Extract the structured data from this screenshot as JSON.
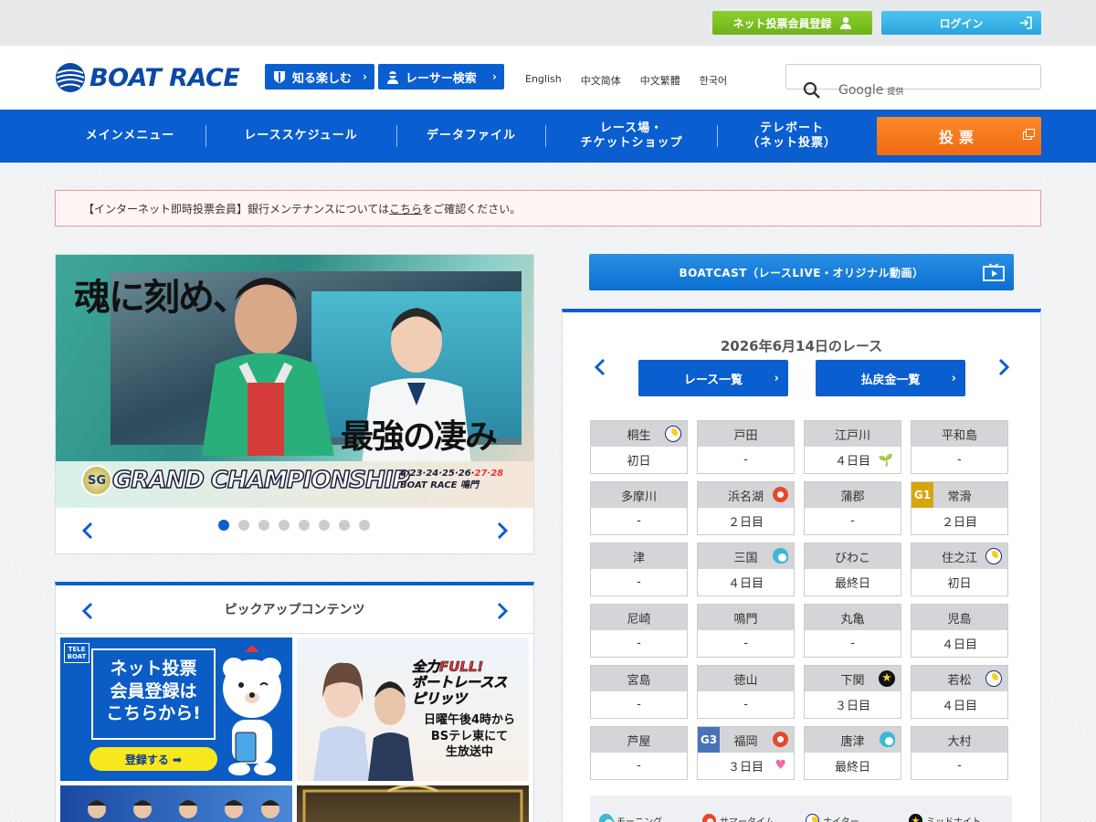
{
  "topbar": {
    "register_label": "ネット投票会員登録",
    "login_label": "ログイン"
  },
  "header": {
    "logo": "BOAT RACE",
    "btn_enjoy": "知る楽しむ",
    "btn_racer": "レーサー検索",
    "langs": [
      "English",
      "中文简体",
      "中文繁體",
      "한국어"
    ],
    "search_brand": "Google",
    "search_suffix": "提供"
  },
  "nav": {
    "items": [
      "メインメニュー",
      "レーススケジュール",
      "データファイル",
      "レース場・\nチケットショップ",
      "テレボート\n（ネット投票）"
    ],
    "vote": "投票"
  },
  "notice": {
    "prefix": "【インターネット即時投票会員】銀行メンテナンスについては",
    "link": "こちら",
    "suffix": "をご確認ください。"
  },
  "banner": {
    "catch1": "魂に刻め、",
    "catch2": "最強の凄み",
    "title": "GRAND CHAMPIONSHIP",
    "badge": "SG",
    "date_main": "6/23·24·25·26·",
    "date_red": "27·28",
    "venue": "BOAT RACE 鳴門",
    "slide_count": 8,
    "active_slide": 1
  },
  "pickup": {
    "title": "ピックアップコンテンツ",
    "card1_text": "ネット投票\n会員登録は\nこちらから!",
    "card1_btn": "登録する ➡",
    "card1_brand": "TELE\nBOAT",
    "card2_text": "日曜午後4時から\nBSテレ東にて\n生放送中",
    "card2_title": "全力FULL!\nボートレーススピリッツ"
  },
  "boatcast": {
    "label": "BOATCAST（レースLIVE・オリジナル動画）"
  },
  "races": {
    "date_title": "2026年6月14日のレース",
    "btn_list": "レース一覧",
    "btn_payout": "払戻金一覧",
    "venues": [
      {
        "name": "桐生",
        "day": "初日",
        "icon": "night"
      },
      {
        "name": "戸田",
        "day": "-"
      },
      {
        "name": "江戸川",
        "day": "４日目",
        "extra": "leaf"
      },
      {
        "name": "平和島",
        "day": "-"
      },
      {
        "name": "多摩川",
        "day": "-"
      },
      {
        "name": "浜名湖",
        "day": "２日目",
        "icon": "summer"
      },
      {
        "name": "蒲郡",
        "day": "-"
      },
      {
        "name": "常滑",
        "day": "２日目",
        "grade": "G1"
      },
      {
        "name": "津",
        "day": "-"
      },
      {
        "name": "三国",
        "day": "４日目",
        "icon": "morning"
      },
      {
        "name": "びわこ",
        "day": "最終日"
      },
      {
        "name": "住之江",
        "day": "初日",
        "icon": "night"
      },
      {
        "name": "尼崎",
        "day": "-"
      },
      {
        "name": "鳴門",
        "day": "-"
      },
      {
        "name": "丸亀",
        "day": "-"
      },
      {
        "name": "児島",
        "day": "４日目"
      },
      {
        "name": "宮島",
        "day": "-"
      },
      {
        "name": "徳山",
        "day": "-"
      },
      {
        "name": "下関",
        "day": "３日目",
        "icon": "midnight"
      },
      {
        "name": "若松",
        "day": "４日目",
        "icon": "night"
      },
      {
        "name": "芦屋",
        "day": "-"
      },
      {
        "name": "福岡",
        "day": "３日目",
        "icon": "summer",
        "grade": "G3",
        "extra": "heart"
      },
      {
        "name": "唐津",
        "day": "最終日",
        "icon": "morning"
      },
      {
        "name": "大村",
        "day": "-"
      }
    ],
    "legend": [
      {
        "label": "モーニング",
        "icon": "morning"
      },
      {
        "label": "サマータイム",
        "icon": "summer"
      },
      {
        "label": "ナイター",
        "icon": "night"
      },
      {
        "label": "ミッドナイト",
        "icon": "midnight"
      }
    ]
  },
  "colors": {
    "primary": "#0a5ecf",
    "vote": "#f37a1c",
    "register": "#7cc223",
    "login": "#38b6e8"
  }
}
